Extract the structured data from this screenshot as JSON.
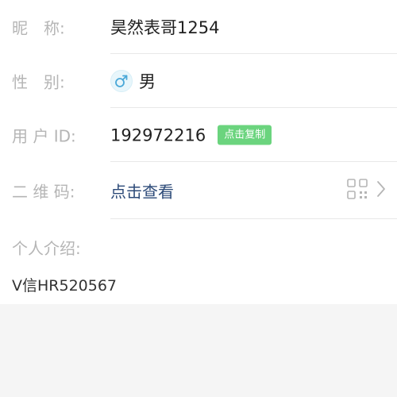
{
  "profile": {
    "nickname": {
      "label": "昵　称:",
      "value": "昊然表哥1254"
    },
    "gender": {
      "label": "性　别:",
      "value": "男",
      "icon": "male-icon"
    },
    "user_id": {
      "label": "用 户 ID:",
      "value": "192972216",
      "copy_label": "点击复制"
    },
    "qrcode": {
      "label": "二 维 码:",
      "link_text": "点击查看",
      "icon": "qr-code-icon"
    },
    "bio": {
      "label": "个人介绍:",
      "value": "V信HR520567"
    }
  },
  "colors": {
    "label": "#b5b5b5",
    "value": "#222222",
    "link": "#2c4a78",
    "copy_badge": "#6bd47e",
    "male_icon": "#4aa8d8",
    "background": "#f5f5f5"
  }
}
